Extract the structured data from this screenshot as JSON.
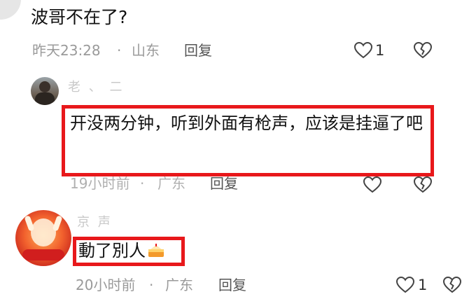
{
  "comment1": {
    "text": "波哥不在了?",
    "time": "昨天23:28",
    "sep": "·",
    "location": "山东",
    "reply": "回复",
    "like_count": "1",
    "like_icon": "heart-outline",
    "dislike_icon": "broken-heart-outline"
  },
  "comment2": {
    "username": "老 、 二",
    "text": "开没两分钟，听到外面有枪声，应该是挂逼了吧",
    "time": "19小时前",
    "sep": "·",
    "location": "广东",
    "reply": "回复",
    "highlight_color": "#e8181b"
  },
  "comment3": {
    "username": "京 声",
    "text": "動了別人",
    "emoji": "cake",
    "time": "20小时前",
    "sep": "·",
    "location": "广东",
    "reply": "回复",
    "like_count": "1",
    "highlight_color": "#e8181b"
  }
}
